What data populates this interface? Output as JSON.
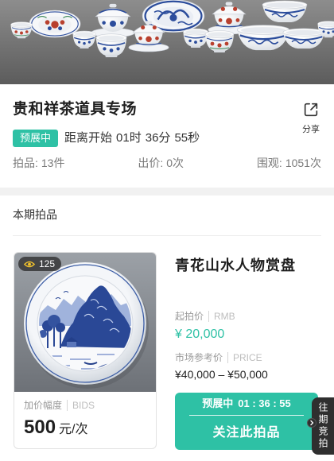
{
  "session": {
    "title": "贵和祥茶道具专场",
    "share": {
      "label": "分享",
      "icon": "share-icon"
    },
    "status_badge": "预展中",
    "countdown": {
      "prefix": "距离开始",
      "hours": "01",
      "hours_unit": "时",
      "minutes": "36",
      "minutes_unit": "分",
      "seconds": "55",
      "seconds_unit": "秒"
    },
    "stats": [
      {
        "label": "拍品:",
        "value": "13件"
      },
      {
        "label": "出价:",
        "value": "0次"
      },
      {
        "label": "围观:",
        "value": "1051次"
      }
    ]
  },
  "section_title": "本期拍品",
  "lot": {
    "view_icon": "eye-icon",
    "views": "125",
    "title": "青花山水人物赏盘",
    "start_price": {
      "label": "起拍价",
      "unit": "RMB",
      "value": "¥ 20,000"
    },
    "market_price": {
      "label": "市场参考价",
      "unit": "PRICE",
      "value": "¥40,000 – ¥50,000"
    },
    "increment": {
      "label": "加价幅度",
      "unit": "BIDS",
      "value": "500",
      "suffix": "元/次"
    },
    "follow_button": {
      "status": "预展中",
      "countdown": "01 : 36 : 55",
      "label": "关注此拍品"
    }
  },
  "floating_tab": {
    "label": "往期竞拍",
    "icon": "chevron-right-icon"
  },
  "colors": {
    "accent": "#2ec1a5",
    "text": "#222222",
    "muted": "#999999",
    "tab_bg": "#2f2f2f",
    "view_icon": "#f2c22d"
  }
}
